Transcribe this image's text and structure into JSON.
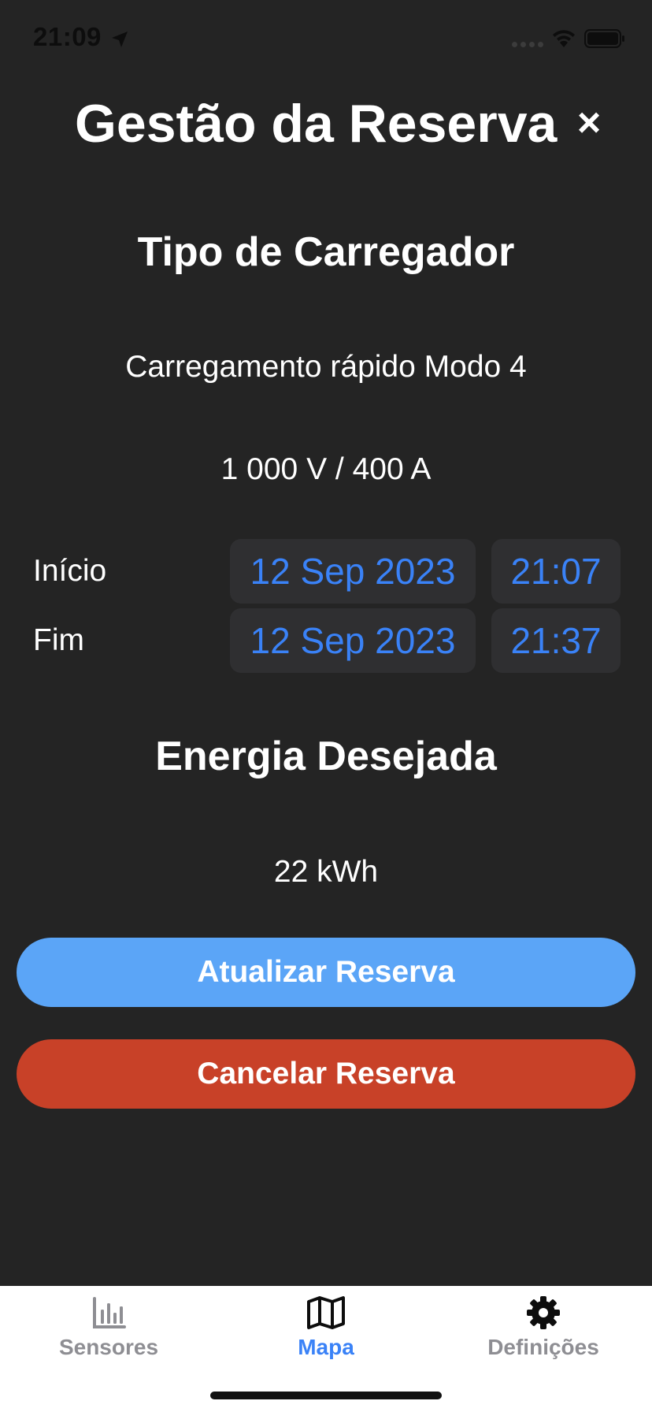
{
  "status_bar": {
    "time": "21:09"
  },
  "header": {
    "title": "Gestão da Reserva",
    "close_label": "×"
  },
  "charger": {
    "section_title": "Tipo de Carregador",
    "type": "Carregamento rápido Modo 4",
    "spec": "1 000 V / 400 A"
  },
  "schedule": {
    "start": {
      "label": "Início",
      "date": "12 Sep 2023",
      "time": "21:07"
    },
    "end": {
      "label": "Fim",
      "date": "12 Sep 2023",
      "time": "21:37"
    }
  },
  "energy": {
    "section_title": "Energia Desejada",
    "value": "22 kWh"
  },
  "actions": {
    "update_label": "Atualizar Reserva",
    "cancel_label": "Cancelar Reserva"
  },
  "tabbar": {
    "items": [
      {
        "label": "Sensores",
        "icon": "bar-chart-icon",
        "active": false
      },
      {
        "label": "Mapa",
        "icon": "map-icon",
        "active": true
      },
      {
        "label": "Definições",
        "icon": "gear-icon",
        "active": false
      }
    ]
  },
  "colors": {
    "background": "#242424",
    "accent": "#3a82f7",
    "update_button": "#5ba5f7",
    "cancel_button": "#c84128",
    "tab_inactive": "#8e8e93",
    "tab_active": "#3a82f7"
  }
}
